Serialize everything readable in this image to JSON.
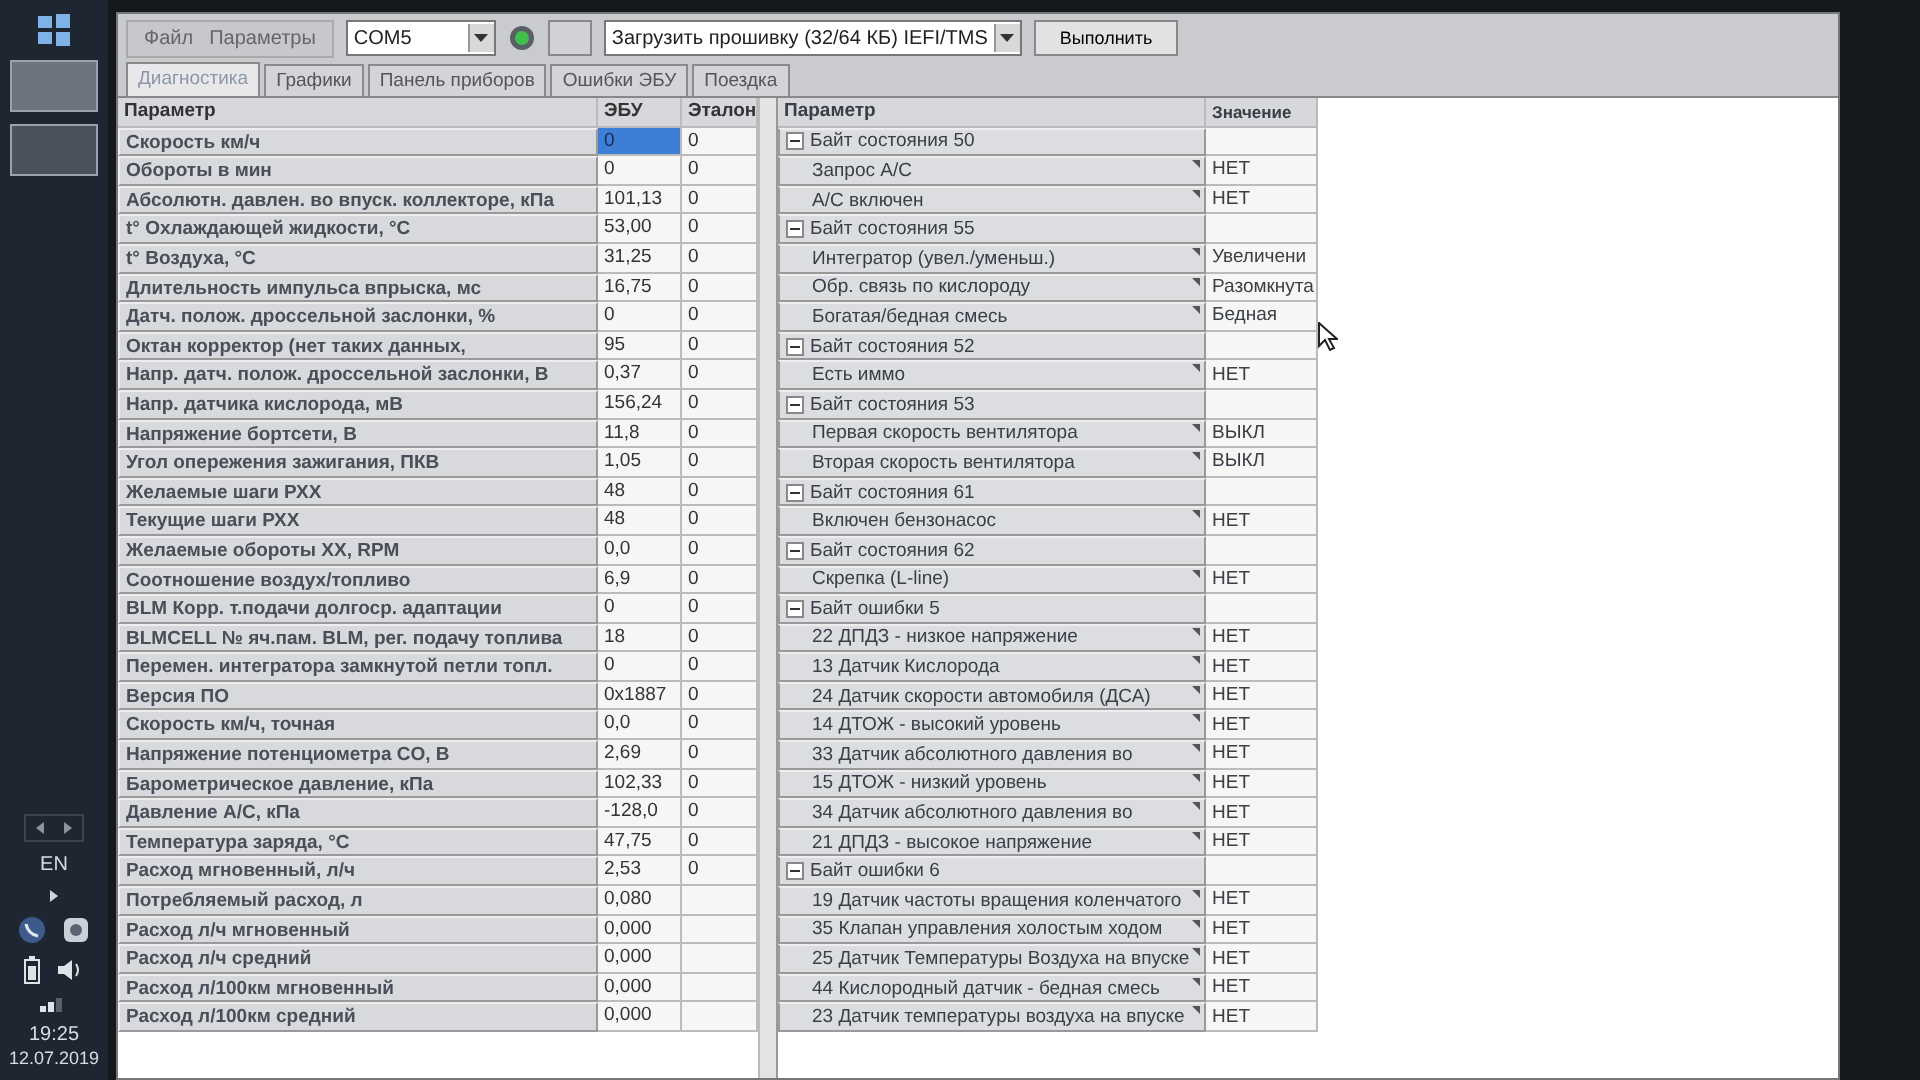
{
  "window": {
    "menu": [
      "Файл",
      "Параметры"
    ]
  },
  "toolbar": {
    "port": "COM5",
    "connected": true,
    "action": "Загрузить прошивку (32/64 КБ) IEFI/TMS",
    "run_button": "Выполнить"
  },
  "tabs": [
    {
      "label": "Диагностика",
      "selected": true
    },
    {
      "label": "Графики",
      "selected": false
    },
    {
      "label": "Панель приборов",
      "selected": false
    },
    {
      "label": "Ошибки ЭБУ",
      "selected": false
    },
    {
      "label": "Поездка",
      "selected": false
    }
  ],
  "params_table": {
    "columns": [
      "Параметр",
      "ЭБУ",
      "Эталон"
    ],
    "rows": [
      {
        "name": "Скорость км/ч",
        "ecu": "0",
        "reference": "0",
        "selected": true
      },
      {
        "name": "Обороты в мин",
        "ecu": "0",
        "reference": "0",
        "selected": false
      },
      {
        "name": "Абсолютн. давлен. во впуск. коллекторе, кПа",
        "ecu": "101,13",
        "reference": "0",
        "selected": false
      },
      {
        "name": "t° Охлаждающей жидкости, °C",
        "ecu": "53,00",
        "reference": "0",
        "selected": false
      },
      {
        "name": "t° Воздуха, °C",
        "ecu": "31,25",
        "reference": "0",
        "selected": false
      },
      {
        "name": "Длительность импульса впрыска, мс",
        "ecu": "16,75",
        "reference": "0",
        "selected": false
      },
      {
        "name": "Датч. полож. дроссельной заслонки, %",
        "ecu": "0",
        "reference": "0",
        "selected": false
      },
      {
        "name": "Октан корректор (нет таких данных,",
        "ecu": "95",
        "reference": "0",
        "selected": false
      },
      {
        "name": "Напр. датч. полож. дроссельной заслонки, В",
        "ecu": "0,37",
        "reference": "0",
        "selected": false
      },
      {
        "name": "Напр. датчика кислорода, мВ",
        "ecu": "156,24",
        "reference": "0",
        "selected": false
      },
      {
        "name": "Напряжение бортсети, В",
        "ecu": "11,8",
        "reference": "0",
        "selected": false
      },
      {
        "name": "Угол опережения зажигания, ПКВ",
        "ecu": "1,05",
        "reference": "0",
        "selected": false
      },
      {
        "name": "Желаемые шаги РХХ",
        "ecu": "48",
        "reference": "0",
        "selected": false
      },
      {
        "name": "Текущие шаги РХХ",
        "ecu": "48",
        "reference": "0",
        "selected": false
      },
      {
        "name": "Желаемые обороты ХХ, RPM",
        "ecu": "0,0",
        "reference": "0",
        "selected": false
      },
      {
        "name": "Соотношение воздух/топливо",
        "ecu": "6,9",
        "reference": "0",
        "selected": false
      },
      {
        "name": "BLM Корр. т.подачи долгоср. адаптации",
        "ecu": "0",
        "reference": "0",
        "selected": false
      },
      {
        "name": "BLMCELL № яч.пам. BLM, рег. подачу топлива",
        "ecu": "18",
        "reference": "0",
        "selected": false
      },
      {
        "name": "Перемен. интегратора замкнутой петли топл.",
        "ecu": "0",
        "reference": "0",
        "selected": false
      },
      {
        "name": "Версия ПО",
        "ecu": "0x1887",
        "reference": "0",
        "selected": false
      },
      {
        "name": "Скорость км/ч, точная",
        "ecu": "0,0",
        "reference": "0",
        "selected": false
      },
      {
        "name": "Напряжение потенциометра CO, В",
        "ecu": "2,69",
        "reference": "0",
        "selected": false
      },
      {
        "name": "Барометрическое давление, кПа",
        "ecu": "102,33",
        "reference": "0",
        "selected": false
      },
      {
        "name": "Давление A/C, кПа",
        "ecu": "-128,0",
        "reference": "0",
        "selected": false
      },
      {
        "name": "Температура заряда, °C",
        "ecu": "47,75",
        "reference": "0",
        "selected": false
      },
      {
        "name": "Расход мгновенный, л/ч",
        "ecu": "2,53",
        "reference": "0",
        "selected": false
      },
      {
        "name": "Потребляемый расход, л",
        "ecu": "0,080",
        "selected": false
      },
      {
        "name": "Расход л/ч мгновенный",
        "ecu": "0,000",
        "selected": false
      },
      {
        "name": "Расход л/ч средний",
        "ecu": "0,000",
        "selected": false
      },
      {
        "name": "Расход л/100км мгновенный",
        "ecu": "0,000",
        "selected": false
      },
      {
        "name": "Расход л/100км средний",
        "ecu": "0,000",
        "selected": false
      }
    ]
  },
  "flags_table": {
    "columns": [
      "Параметр",
      "Значение"
    ],
    "groups": [
      {
        "name": "Байт состояния 50",
        "expanded": true,
        "children": [
          {
            "name": "Запрос A/C",
            "value": "НЕТ"
          },
          {
            "name": "A/C включен",
            "value": "НЕТ"
          }
        ]
      },
      {
        "name": "Байт состояния 55",
        "expanded": true,
        "children": [
          {
            "name": "Интегратор (увел./уменьш.)",
            "value": "Увеличени"
          },
          {
            "name": "Обр. связь по кислороду",
            "value": "Разомкнута"
          },
          {
            "name": "Богатая/бедная смесь",
            "value": "Бедная"
          }
        ]
      },
      {
        "name": "Байт состояния 52",
        "expanded": true,
        "children": [
          {
            "name": "Есть иммо",
            "value": "НЕТ"
          }
        ]
      },
      {
        "name": "Байт состояния 53",
        "expanded": true,
        "children": [
          {
            "name": "Первая скорость вентилятора",
            "value": "ВЫКЛ"
          },
          {
            "name": "Вторая скорость вентилятора",
            "value": "ВЫКЛ"
          }
        ]
      },
      {
        "name": "Байт состояния 61",
        "expanded": true,
        "children": [
          {
            "name": "Включен бензонасос",
            "value": "НЕТ"
          }
        ]
      },
      {
        "name": "Байт состояния 62",
        "expanded": true,
        "children": [
          {
            "name": "Скрепка (L-line)",
            "value": "НЕТ"
          }
        ]
      },
      {
        "name": "Байт ошибки 5",
        "expanded": true,
        "children": [
          {
            "name": "22 ДПДЗ - низкое напряжение",
            "value": "НЕТ"
          },
          {
            "name": "13 Датчик Кислорода",
            "value": "НЕТ"
          },
          {
            "name": "24 Датчик скорости автомобиля (ДСА)",
            "value": "НЕТ"
          },
          {
            "name": "14 ДТОЖ - высокий уровень",
            "value": "НЕТ"
          },
          {
            "name": "33 Датчик абсолютного давления во",
            "value": "НЕТ"
          },
          {
            "name": "15 ДТОЖ - низкий уровень",
            "value": "НЕТ"
          },
          {
            "name": "34 Датчик абсолютного давления во",
            "value": "НЕТ"
          },
          {
            "name": "21 ДПДЗ - высокое напряжение",
            "value": "НЕТ"
          }
        ]
      },
      {
        "name": "Байт ошибки 6",
        "expanded": true,
        "children": [
          {
            "name": "19 Датчик частоты вращения коленчатого",
            "value": "НЕТ"
          },
          {
            "name": "35 Клапан управления холостым ходом",
            "value": "НЕТ"
          },
          {
            "name": "25 Датчик Температуры Воздуха на впуске",
            "value": "НЕТ"
          },
          {
            "name": "44 Кислородный датчик - бедная смесь",
            "value": "НЕТ"
          },
          {
            "name": "23 Датчик температуры воздуха на впуске",
            "value": "НЕТ"
          }
        ]
      }
    ]
  },
  "taskbar": {
    "language": "EN",
    "time": "19:25",
    "date": "12.07.2019"
  }
}
